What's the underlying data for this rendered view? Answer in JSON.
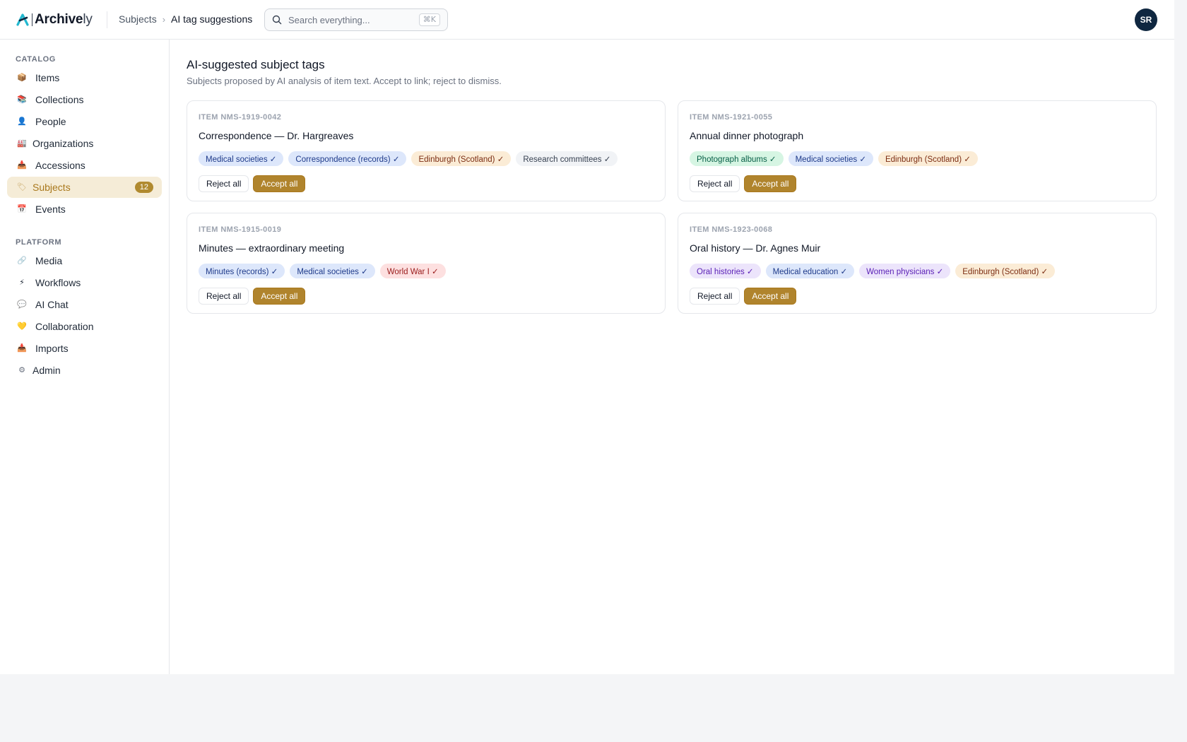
{
  "header": {
    "logo_bold": "Archive",
    "logo_light": "ly",
    "breadcrumb": {
      "parent": "Subjects",
      "separator": "›",
      "current": "AI tag suggestions"
    },
    "search": {
      "placeholder": "Search everything...",
      "shortcut": "⌘K"
    },
    "user_initials": "SR"
  },
  "sidebar": {
    "catalog_label": "CATALOG",
    "catalog_items": [
      {
        "label": "Items",
        "icon": "box-icon",
        "glyph": "📦"
      },
      {
        "label": "Collections",
        "icon": "books-icon",
        "glyph": "📚"
      },
      {
        "label": "People",
        "icon": "person-icon",
        "glyph": "👤"
      },
      {
        "label": "Organizations",
        "icon": "building-icon",
        "glyph": "🏭"
      },
      {
        "label": "Accessions",
        "icon": "inbox-icon",
        "glyph": "📥"
      },
      {
        "label": "Subjects",
        "icon": "tag-icon",
        "glyph": "🏷",
        "badge": "12",
        "active": true
      },
      {
        "label": "Events",
        "icon": "calendar-icon",
        "glyph": "📅"
      }
    ],
    "platform_label": "PLATFORM",
    "platform_items": [
      {
        "label": "Media",
        "icon": "paperclip-icon",
        "glyph": "🔗"
      },
      {
        "label": "Workflows",
        "icon": "lightning-icon",
        "glyph": "⚡"
      },
      {
        "label": "AI Chat",
        "icon": "chat-bubble-icon",
        "glyph": "💬"
      },
      {
        "label": "Collaboration",
        "icon": "heart-icon",
        "glyph": "💛"
      },
      {
        "label": "Imports",
        "icon": "import-icon",
        "glyph": "📥"
      },
      {
        "label": "Admin",
        "icon": "gear-icon",
        "glyph": "⚙"
      }
    ]
  },
  "main": {
    "title": "AI-suggested subject tags",
    "subtitle": "Subjects proposed by AI analysis of item text. Accept to link; reject to dismiss.",
    "reject_label": "Reject all",
    "accept_label": "Accept all",
    "cards": [
      {
        "ref": "ITEM NMS-1919-0042",
        "title": "Correspondence — Dr. Hargreaves",
        "tags": [
          {
            "label": "Medical societies ✓",
            "color": "blue"
          },
          {
            "label": "Correspondence (records) ✓",
            "color": "blue"
          },
          {
            "label": "Edinburgh (Scotland) ✓",
            "color": "orange"
          },
          {
            "label": "Research committees ✓",
            "color": "gray"
          }
        ]
      },
      {
        "ref": "ITEM NMS-1921-0055",
        "title": "Annual dinner photograph",
        "tags": [
          {
            "label": "Photograph albums ✓",
            "color": "green"
          },
          {
            "label": "Medical societies ✓",
            "color": "blue"
          },
          {
            "label": "Edinburgh (Scotland) ✓",
            "color": "orange"
          }
        ]
      },
      {
        "ref": "ITEM NMS-1915-0019",
        "title": "Minutes — extraordinary meeting",
        "tags": [
          {
            "label": "Minutes (records) ✓",
            "color": "blue"
          },
          {
            "label": "Medical societies ✓",
            "color": "blue"
          },
          {
            "label": "World War I ✓",
            "color": "red"
          }
        ]
      },
      {
        "ref": "ITEM NMS-1923-0068",
        "title": "Oral history — Dr. Agnes Muir",
        "tags": [
          {
            "label": "Oral histories ✓",
            "color": "purple"
          },
          {
            "label": "Medical education ✓",
            "color": "blue"
          },
          {
            "label": "Women physicians ✓",
            "color": "purple"
          },
          {
            "label": "Edinburgh (Scotland) ✓",
            "color": "orange"
          }
        ]
      }
    ]
  },
  "colors": {
    "accent": "#b0842d",
    "active_nav_bg": "#f5ecd7",
    "avatar_bg": "#0f2740",
    "logo_mark": "#22b8cf"
  }
}
